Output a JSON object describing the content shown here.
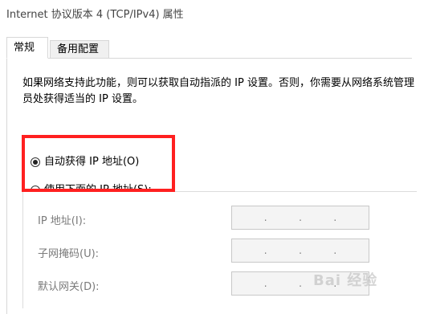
{
  "window": {
    "title": "Internet 协议版本 4 (TCP/IPv4) 属性"
  },
  "tabs": [
    {
      "label": "常规"
    },
    {
      "label": "备用配置"
    }
  ],
  "description": "如果网络支持此功能，则可以获取自动指派的 IP 设置。否则，你需要从网络系统管理员处获得适当的 IP 设置。",
  "options": {
    "auto": {
      "label": "自动获得 IP 地址(O)",
      "checked": true
    },
    "manual": {
      "label": "使用下面的 IP 地址(S):",
      "checked": false
    }
  },
  "fields": [
    {
      "label": "IP 地址(I):",
      "value": ". . ."
    },
    {
      "label": "子网掩码(U):",
      "value": ". . ."
    },
    {
      "label": "默认网关(D):",
      "value": ". . ."
    }
  ],
  "watermark": "Bai 经验",
  "colors": {
    "highlight": "#ff2020",
    "disabled_text": "#7a7a7a"
  }
}
